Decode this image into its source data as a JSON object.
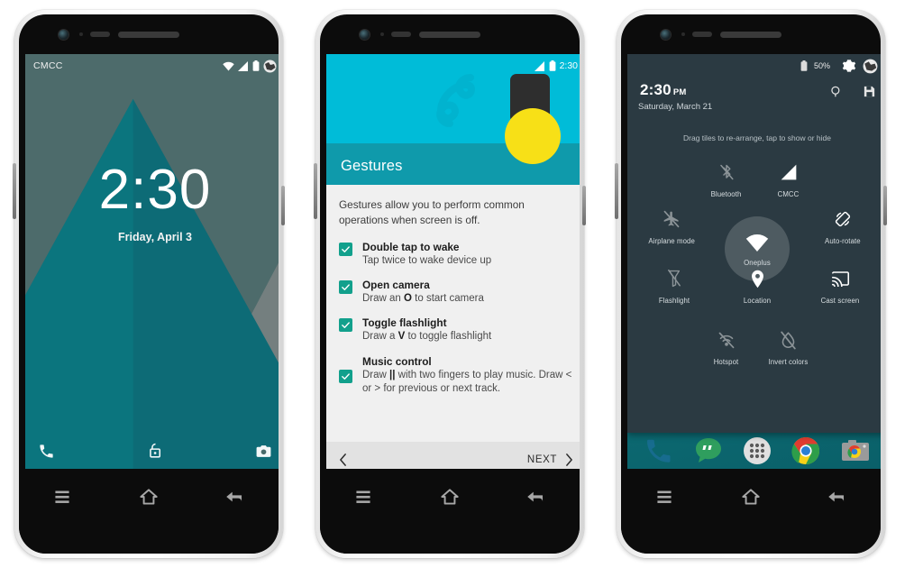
{
  "scene": {
    "title": "OnePlus One OxygenOS screenshots",
    "device_count": 3
  },
  "colors": {
    "lock_sky": "#4d6b6b",
    "lock_mountain": "#0d6b76",
    "lock_mountain_light": "#8c8c8c",
    "hero_cyan": "#00bcd8",
    "hero_band_teal": "#0f9aab",
    "checkbox_green": "#12a08c",
    "pen_yellow": "#f7e017",
    "panel_dark": "#2b3a42",
    "home_teal": "#0f7d84"
  },
  "phone1": {
    "name": "lock-screen",
    "statusbar": {
      "carrier": "CMCC",
      "icons": [
        "wifi-icon",
        "signal-icon",
        "battery-icon",
        "globe-icon"
      ]
    },
    "clock": {
      "time": "2:30",
      "date": "Friday, April 3"
    },
    "shortcuts": [
      {
        "name": "phone-shortcut",
        "icon": "phone-icon"
      },
      {
        "name": "unlock-shortcut",
        "icon": "lock-icon"
      },
      {
        "name": "camera-shortcut",
        "icon": "camera-icon"
      }
    ],
    "navbar": [
      {
        "name": "menu-button",
        "icon": "menu-icon"
      },
      {
        "name": "home-button",
        "icon": "home-icon"
      },
      {
        "name": "back-button",
        "icon": "back-icon"
      }
    ]
  },
  "phone2": {
    "name": "gestures-setup-screen",
    "statusbar": {
      "time": "2:30",
      "icons": [
        "signal-icon",
        "battery-icon"
      ]
    },
    "hero": {
      "title": "Gestures"
    },
    "intro": "Gestures allow you to perform common operations when screen is off.",
    "items": [
      {
        "title": "Double tap to wake",
        "desc": "Tap twice to wake device up",
        "checked": true
      },
      {
        "title": "Open camera",
        "desc_pre": "Draw an ",
        "desc_bold": "O",
        "desc_post": " to start camera",
        "checked": true
      },
      {
        "title": "Toggle flashlight",
        "desc_pre": "Draw a ",
        "desc_bold": "V",
        "desc_post": " to toggle flashlight",
        "checked": true
      },
      {
        "title": "Music control",
        "desc_pre": "Draw ",
        "desc_bold": "||",
        "desc_post": " with two fingers to play music. Draw < or > for previous or next track.",
        "checked": true
      }
    ],
    "footer": {
      "back_icon": "chevron-left-icon",
      "next_label": "NEXT",
      "next_icon": "chevron-right-icon"
    },
    "navbar": [
      {
        "name": "menu-button",
        "icon": "menu-icon"
      },
      {
        "name": "home-button",
        "icon": "home-icon"
      },
      {
        "name": "back-button",
        "icon": "back-icon"
      }
    ]
  },
  "phone3": {
    "name": "quick-settings-edit-screen",
    "statusbar": {
      "battery_label": "50%",
      "icons": [
        "battery-icon",
        "gear-icon",
        "globe-icon"
      ]
    },
    "header": {
      "time": "2:30",
      "meridiem": "PM",
      "date": "Saturday, March 21",
      "actions": [
        {
          "name": "search-action",
          "icon": "search-icon"
        },
        {
          "name": "save-action",
          "icon": "save-icon"
        }
      ]
    },
    "hint": "Drag tiles to re-arrange, tap to show or hide",
    "tiles": [
      {
        "label": "Bluetooth",
        "icon": "bluetooth-off-icon",
        "dim": true
      },
      {
        "label": "CMCC",
        "icon": "signal-icon",
        "dim": false
      },
      {
        "label": "Airplane mode",
        "icon": "airplane-off-icon",
        "dim": true
      },
      {
        "label": "Auto-rotate",
        "icon": "autorotate-icon",
        "dim": false
      },
      {
        "label": "Flashlight",
        "icon": "flashlight-off-icon",
        "dim": true
      },
      {
        "label": "Location",
        "icon": "location-icon",
        "dim": false
      },
      {
        "label": "Cast screen",
        "icon": "cast-icon",
        "dim": false
      },
      {
        "label": "Hotspot",
        "icon": "hotspot-off-icon",
        "dim": true
      },
      {
        "label": "Invert colors",
        "icon": "invert-colors-off-icon",
        "dim": true
      }
    ],
    "dragging_tile": {
      "label": "Oneplus",
      "icon": "wifi-icon"
    },
    "dock": [
      {
        "name": "dock-phone",
        "icon": "phone-icon"
      },
      {
        "name": "dock-messages",
        "icon": "messages-icon"
      },
      {
        "name": "dock-app-drawer",
        "icon": "apps-grid-icon"
      },
      {
        "name": "dock-chrome",
        "icon": "chrome-icon"
      },
      {
        "name": "dock-camera",
        "icon": "camera-icon"
      }
    ],
    "navbar": [
      {
        "name": "menu-button",
        "icon": "menu-icon"
      },
      {
        "name": "home-button",
        "icon": "home-icon"
      },
      {
        "name": "back-button",
        "icon": "back-icon"
      }
    ]
  }
}
